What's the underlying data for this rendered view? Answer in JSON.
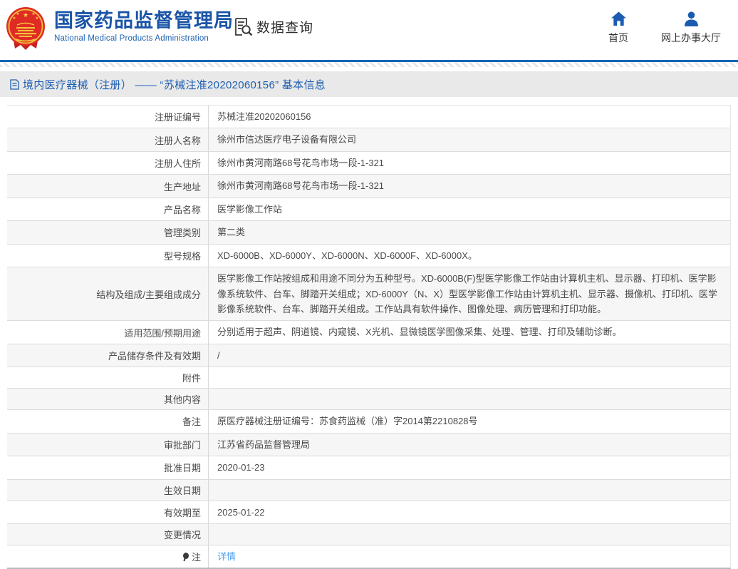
{
  "header": {
    "logo": {
      "title": "国家药品监督管理局",
      "subtitle": "National Medical Products Administration",
      "emblem_icon": "china-national-emblem",
      "title_color": "#1b55a7"
    },
    "data_query": {
      "label": "数据查询",
      "icon": "document-search-icon"
    },
    "nav": [
      {
        "label": "首页",
        "icon": "home-icon"
      },
      {
        "label": "网上办事大厅",
        "icon": "user-icon"
      }
    ],
    "accent_color": "#1565b5"
  },
  "breadcrumb": {
    "icon": "document-icon",
    "text": "境内医疗器械（注册） —— “苏械注准20202060156” 基本信息",
    "text_color": "#1e5fb2"
  },
  "table": {
    "link_color": "#4f9ff0",
    "rows": [
      {
        "label": "注册证编号",
        "value": "苏械注准20202060156"
      },
      {
        "label": "注册人名称",
        "value": "徐州市信达医疗电子设备有限公司"
      },
      {
        "label": "注册人住所",
        "value": "徐州市黄河南路68号花鸟市场一段-1-321"
      },
      {
        "label": "生产地址",
        "value": "徐州市黄河南路68号花鸟市场一段-1-321"
      },
      {
        "label": "产品名称",
        "value": "医学影像工作站"
      },
      {
        "label": "管理类别",
        "value": "第二类"
      },
      {
        "label": "型号规格",
        "value": "XD-6000B、XD-6000Y、XD-6000N、XD-6000F、XD-6000X。"
      },
      {
        "label": "结构及组成/主要组成成分",
        "value": "医学影像工作站按组成和用途不同分为五种型号。XD-6000B(F)型医学影像工作站由计算机主机、显示器、打印机、医学影像系统软件、台车、脚踏开关组成；XD-6000Y（N、X）型医学影像工作站由计算机主机、显示器、摄像机、打印机、医学影像系统软件、台车、脚踏开关组成。工作站具有软件操作、图像处理、病历管理和打印功能。",
        "tall": true
      },
      {
        "label": "适用范围/预期用途",
        "value": "分别适用于超声、阴道镜、内窥镜、X光机、显微镜医学图像采集、处理、管理、打印及辅助诊断。"
      },
      {
        "label": "产品储存条件及有效期",
        "value": "/"
      },
      {
        "label": "附件",
        "value": ""
      },
      {
        "label": "其他内容",
        "value": ""
      },
      {
        "label": "备注",
        "value": "原医疗器械注册证编号：苏食药监械（准）字2014第2210828号"
      },
      {
        "label": "审批部门",
        "value": "江苏省药品监督管理局"
      },
      {
        "label": "批准日期",
        "value": "2020-01-23"
      },
      {
        "label": "生效日期",
        "value": ""
      },
      {
        "label": "有效期至",
        "value": "2025-01-22"
      },
      {
        "label": "变更情况",
        "value": ""
      },
      {
        "label": "注",
        "value": "详情",
        "value_is_link": true,
        "label_icon": "balloon-note-icon"
      }
    ]
  }
}
